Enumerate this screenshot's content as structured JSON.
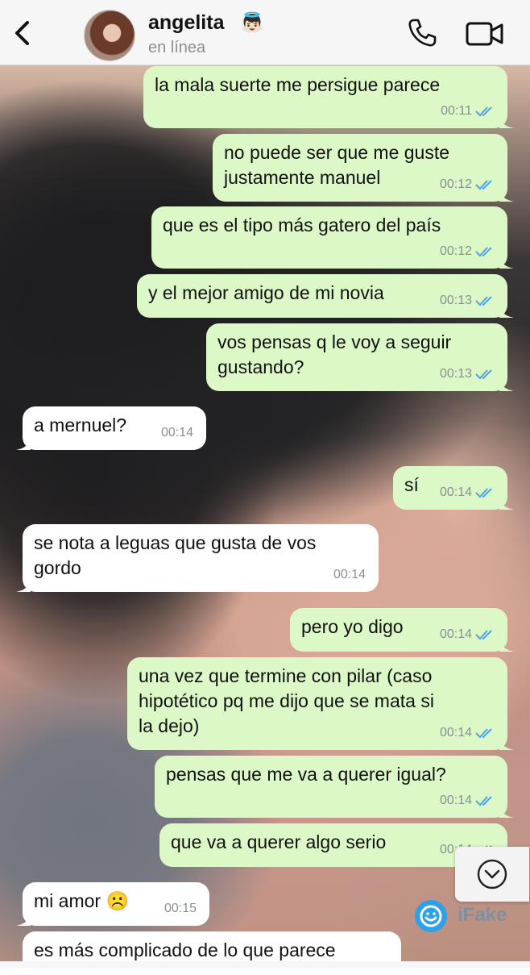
{
  "header": {
    "contact_name": "angelita",
    "contact_emoji": "👼🏻",
    "status": "en línea"
  },
  "icons": {
    "back": "chevron-left-icon",
    "call": "phone-icon",
    "video": "video-camera-icon",
    "scroll": "chevron-down-icon"
  },
  "colors": {
    "outgoing_bubble": "#dcf8c6",
    "incoming_bubble": "#ffffff",
    "read_ticks": "#4fa3e6"
  },
  "messages": [
    {
      "direction": "out",
      "text": "la mala suerte me persigue parece",
      "time": "00:11",
      "read": true
    },
    {
      "direction": "out",
      "text": "no puede ser que me guste\njustamente manuel",
      "time": "00:12",
      "read": true
    },
    {
      "direction": "out",
      "text": "que es el tipo más gatero del país",
      "time": "00:12",
      "read": true
    },
    {
      "direction": "out",
      "text": "y el mejor amigo de mi novia",
      "time": "00:13",
      "read": true
    },
    {
      "direction": "out",
      "text": "vos pensas q le voy a seguir\ngustando?",
      "time": "00:13",
      "read": true
    },
    {
      "direction": "in",
      "text": "a mernuel?",
      "time": "00:14"
    },
    {
      "direction": "out",
      "text": "sí",
      "time": "00:14",
      "read": true
    },
    {
      "direction": "in",
      "text": "se nota a leguas que gusta de vos\ngordo",
      "time": "00:14"
    },
    {
      "direction": "out",
      "text": "pero yo digo",
      "time": "00:14",
      "read": true
    },
    {
      "direction": "out",
      "text": "una vez que termine con pilar (caso\nhipotético pq me dijo que se mata si\nla dejo)",
      "time": "00:14",
      "read": true
    },
    {
      "direction": "out",
      "text": "pensas que me va a querer igual?",
      "time": "00:14",
      "read": true
    },
    {
      "direction": "out",
      "text": "que va a querer algo serio",
      "time": "00:14",
      "read": true
    },
    {
      "direction": "in",
      "text": "mi amor ☹️",
      "time": "00:15"
    },
    {
      "direction": "in",
      "text": "es más complicado de lo que parece",
      "time": ""
    }
  ],
  "watermark": {
    "label": "iFake"
  }
}
